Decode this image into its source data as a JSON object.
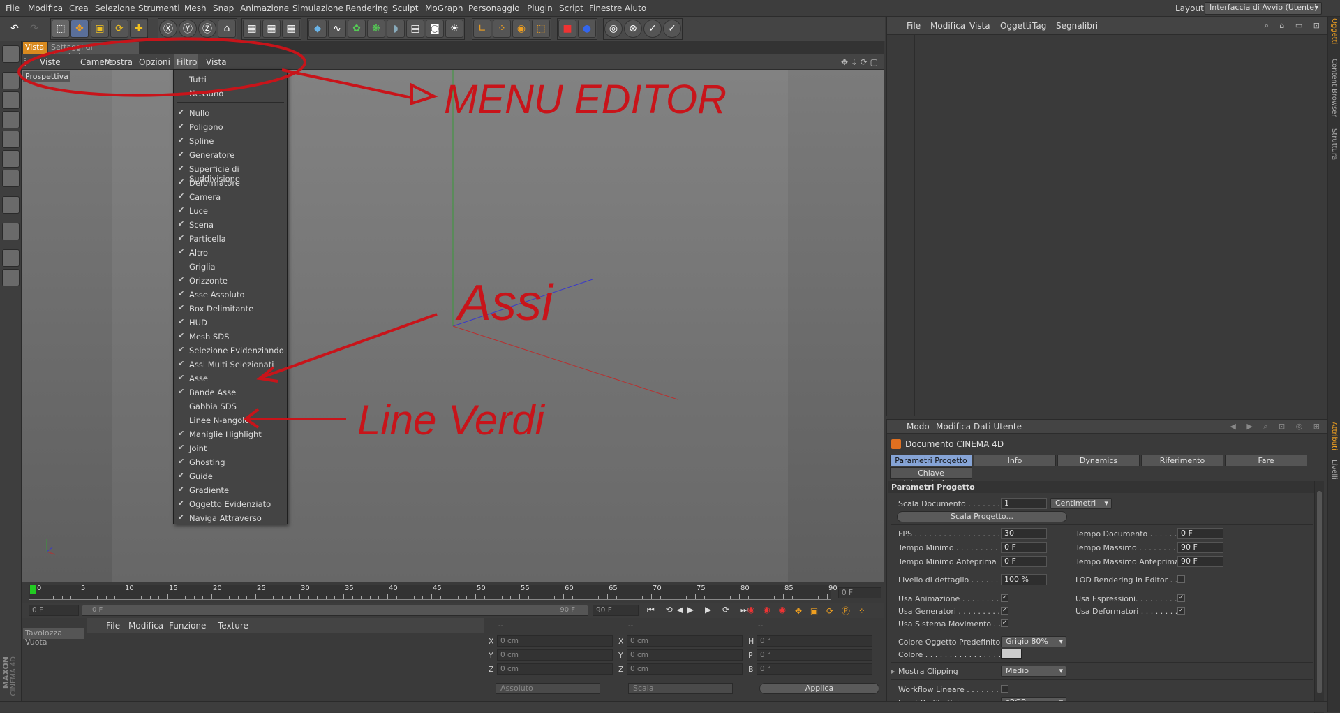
{
  "menubar": {
    "items": [
      "File",
      "Modifica",
      "Crea",
      "Selezione",
      "Strumenti",
      "Mesh",
      "Snap",
      "Animazione",
      "Simulazione",
      "Rendering",
      "Sculpt",
      "MoGraph",
      "Personaggio",
      "Plugin",
      "Script",
      "Finestre",
      "Aiuto"
    ],
    "layout_label": "Layout:",
    "layout_value": "Interfaccia di Avvio (Utente)"
  },
  "viewport": {
    "tab_active": "Vista",
    "tab_inactive": "Settaggi di Rendering...",
    "menu": [
      "Viste",
      "Camere",
      "Mostra",
      "Opzioni",
      "Filtro",
      "Vista"
    ],
    "camera_label": "Prospettiva"
  },
  "filter_menu": {
    "items": [
      {
        "label": "Tutti",
        "checked": false
      },
      {
        "label": "Nessuno",
        "checked": false
      },
      {
        "label": "Nullo",
        "checked": true
      },
      {
        "label": "Poligono",
        "checked": true
      },
      {
        "label": "Spline",
        "checked": true
      },
      {
        "label": "Generatore",
        "checked": true
      },
      {
        "label": "Superficie di Suddivisione",
        "checked": true
      },
      {
        "label": "Deformatore",
        "checked": true
      },
      {
        "label": "Camera",
        "checked": true
      },
      {
        "label": "Luce",
        "checked": true
      },
      {
        "label": "Scena",
        "checked": true
      },
      {
        "label": "Particella",
        "checked": true
      },
      {
        "label": "Altro",
        "checked": true
      },
      {
        "label": "Griglia",
        "checked": false
      },
      {
        "label": "Orizzonte",
        "checked": true
      },
      {
        "label": "Asse Assoluto",
        "checked": true
      },
      {
        "label": "Box Delimitante",
        "checked": true
      },
      {
        "label": "HUD",
        "checked": true
      },
      {
        "label": "Mesh SDS",
        "checked": true
      },
      {
        "label": "Selezione Evidenziando",
        "checked": true
      },
      {
        "label": "Assi Multi Selezionati",
        "checked": true
      },
      {
        "label": "Asse",
        "checked": true
      },
      {
        "label": "Bande Asse",
        "checked": true
      },
      {
        "label": "Gabbia SDS",
        "checked": false
      },
      {
        "label": "Linee N-angolo",
        "checked": false
      },
      {
        "label": "Maniglie Highlight",
        "checked": true
      },
      {
        "label": "Joint",
        "checked": true
      },
      {
        "label": "Ghosting",
        "checked": true
      },
      {
        "label": "Guide",
        "checked": true
      },
      {
        "label": "Gradiente",
        "checked": true
      },
      {
        "label": "Oggetto Evidenziato",
        "checked": true
      },
      {
        "label": "Naviga Attraverso",
        "checked": true
      }
    ]
  },
  "annotations": {
    "menu_editor": "MENU EDITOR",
    "assi": "Assi",
    "line_verdi": "Line Verdi"
  },
  "timeline": {
    "ticks": [
      "0",
      "5",
      "10",
      "15",
      "20",
      "25",
      "30",
      "35",
      "40",
      "45",
      "50",
      "55",
      "60",
      "65",
      "70",
      "75",
      "80",
      "85",
      "90"
    ],
    "frame_field": "0 F",
    "start_field": "0 F",
    "range_start": "0 F",
    "range_end": "90 F",
    "end_field": "90 F"
  },
  "material": {
    "palette_label": "Tavolozza Vuota",
    "menu": [
      "File",
      "Modifica",
      "Funzione",
      "Texture"
    ],
    "brand1": "MAXON",
    "brand2": "CINEMA 4D"
  },
  "coords": {
    "headers": [
      "--",
      "--",
      "--"
    ],
    "rows": [
      [
        "X",
        "0 cm",
        "X",
        "0 cm",
        "H",
        "0 °"
      ],
      [
        "Y",
        "0 cm",
        "Y",
        "0 cm",
        "P",
        "0 °"
      ],
      [
        "Z",
        "0 cm",
        "Z",
        "0 cm",
        "B",
        "0 °"
      ]
    ],
    "mode1": "Assoluto",
    "mode2": "Scala",
    "apply": "Applica"
  },
  "object_manager": {
    "menu": [
      "File",
      "Modifica",
      "Vista",
      "Oggetti",
      "Tag",
      "Segnalibri"
    ]
  },
  "attr": {
    "menu": [
      "Modo",
      "Modifica",
      "Dati Utente"
    ],
    "doc_title": "Documento CINEMA 4D",
    "tabs": [
      "Parametri Progetto",
      "Info",
      "Dynamics",
      "Riferimento",
      "Fare"
    ],
    "tab2": "Chiave Interpolazione",
    "section": "Parametri Progetto",
    "scala_label": "Scala Documento . . . . . . . .",
    "scala_val": "1",
    "scala_unit": "Centimetri",
    "scala_btn": "Scala Progetto...",
    "fps_label": "FPS . . . . . . . . . . . . . . . . . . .",
    "fps_val": "30",
    "tdoc_label": "Tempo Documento . . . . . . .",
    "tdoc_val": "0 F",
    "tmin_label": "Tempo Minimo . . . . . . . . . .",
    "tmin_val": "0 F",
    "tmax_label": "Tempo Massimo . . . . . . . . .",
    "tmax_val": "90 F",
    "tminp_label": "Tempo Minimo Anteprima",
    "tminp_val": "0 F",
    "tmaxp_label": "Tempo Massimo Anteprima",
    "tmaxp_val": "90 F",
    "lod_label": "Livello di dettaglio . . . . . . .",
    "lod_val": "100 %",
    "lodr_label": "LOD Rendering in Editor . .",
    "anim_label": "Usa Animazione . . . . . . . . .",
    "espr_label": "Usa Espressioni. . . . . . . . . .",
    "gen_label": "Usa Generatori . . . . . . . . .",
    "def_label": "Usa Deformatori . . . . . . . . .",
    "mov_label": "Usa Sistema Movimento . . .",
    "col_label": "Colore Oggetto Predefinito",
    "col_val": "Grigio 80%",
    "colore_label": "Colore . . . . . . . . . . . . . . . . .",
    "clip_label": "Mostra Clipping",
    "clip_val": "Medio",
    "wf_label": "Workflow Lineare . . . . . . . .",
    "ip_label": "Input Profilo Colore . . . . . .",
    "ip_val": "sRGB"
  },
  "right_tabs": [
    "Oggetti",
    "Content Browser",
    "Struttura",
    "Attributi",
    "Livelli"
  ],
  "colors": {
    "accent": "#f0a020",
    "annotation": "#c8141a",
    "active_tab": "#86a4d6"
  }
}
